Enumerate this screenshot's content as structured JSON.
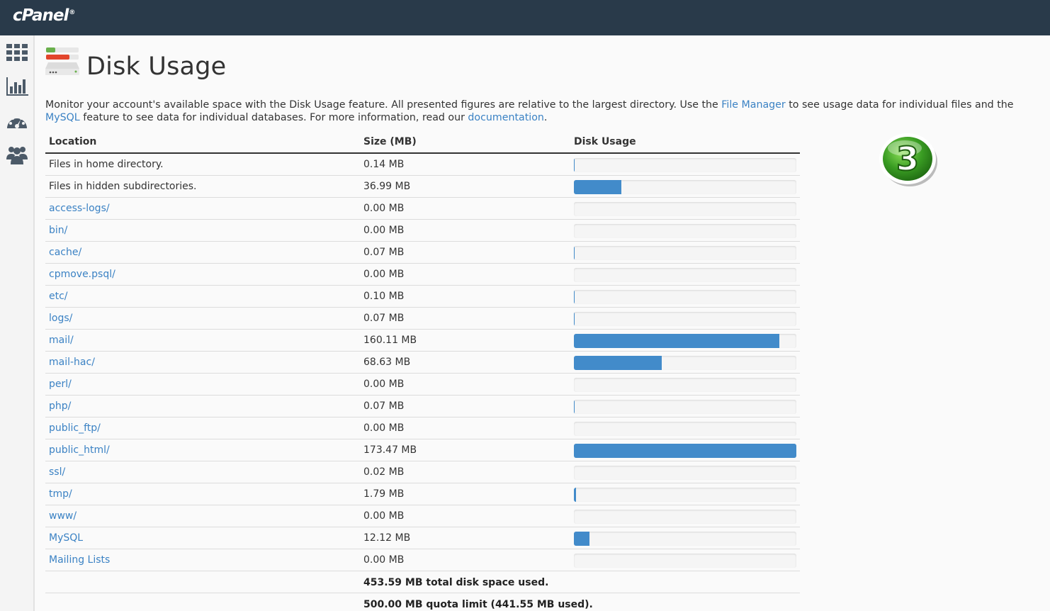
{
  "header": {
    "logo": "cPanel",
    "logo_mark": "®"
  },
  "sidebar": {
    "items": [
      {
        "icon": "grid-icon"
      },
      {
        "icon": "bar-chart-icon"
      },
      {
        "icon": "dashboard-gauge-icon"
      },
      {
        "icon": "users-icon"
      }
    ]
  },
  "page": {
    "title": "Disk Usage",
    "title_icon": "disk-usage-icon",
    "description": {
      "part1": "Monitor your account's available space with the Disk Usage feature. All presented figures are relative to the largest directory. Use the ",
      "file_manager": "File Manager",
      "part2": " to see usage data for individual files and the ",
      "mysql": "MySQL",
      "part3": " feature to see data for individual databases. For more information, read our ",
      "documentation": "documentation",
      "part4": "."
    }
  },
  "table": {
    "headers": {
      "location": "Location",
      "size": "Size (MB)",
      "usage": "Disk Usage"
    },
    "rows": [
      {
        "location": "Files in home directory.",
        "size": "0.14 MB",
        "usage": 0.0008,
        "link": false
      },
      {
        "location": "Files in hidden subdirectories.",
        "size": "36.99 MB",
        "usage": 0.2132,
        "link": false
      },
      {
        "location": "access-logs/",
        "size": "0.00 MB",
        "usage": 0,
        "link": true
      },
      {
        "location": "bin/",
        "size": "0.00 MB",
        "usage": 0,
        "link": true
      },
      {
        "location": "cache/",
        "size": "0.07 MB",
        "usage": 0.0004,
        "link": true
      },
      {
        "location": "cpmove.psql/",
        "size": "0.00 MB",
        "usage": 0,
        "link": true
      },
      {
        "location": "etc/",
        "size": "0.10 MB",
        "usage": 0.0006,
        "link": true
      },
      {
        "location": "logs/",
        "size": "0.07 MB",
        "usage": 0.0004,
        "link": true
      },
      {
        "location": "mail/",
        "size": "160.11 MB",
        "usage": 0.923,
        "link": true
      },
      {
        "location": "mail-hac/",
        "size": "68.63 MB",
        "usage": 0.3956,
        "link": true
      },
      {
        "location": "perl/",
        "size": "0.00 MB",
        "usage": 0,
        "link": true
      },
      {
        "location": "php/",
        "size": "0.07 MB",
        "usage": 0.0004,
        "link": true
      },
      {
        "location": "public_ftp/",
        "size": "0.00 MB",
        "usage": 0,
        "link": true
      },
      {
        "location": "public_html/",
        "size": "173.47 MB",
        "usage": 1.0,
        "link": true
      },
      {
        "location": "ssl/",
        "size": "0.02 MB",
        "usage": 0.0001,
        "link": true
      },
      {
        "location": "tmp/",
        "size": "1.79 MB",
        "usage": 0.0103,
        "link": true
      },
      {
        "location": "www/",
        "size": "0.00 MB",
        "usage": 0,
        "link": true
      },
      {
        "location": "MySQL",
        "size": "12.12 MB",
        "usage": 0.0699,
        "link": true
      },
      {
        "location": "Mailing Lists",
        "size": "0.00 MB",
        "usage": 0,
        "link": true
      }
    ],
    "total": "453.59 MB total disk space used.",
    "quota": "500.00 MB quota limit (441.55 MB used)."
  },
  "badge": {
    "number": "3",
    "color": "#3a9d23"
  },
  "colors": {
    "topbar": "#293a4a",
    "link": "#3b82c4",
    "bar_fill": "#428bca"
  }
}
